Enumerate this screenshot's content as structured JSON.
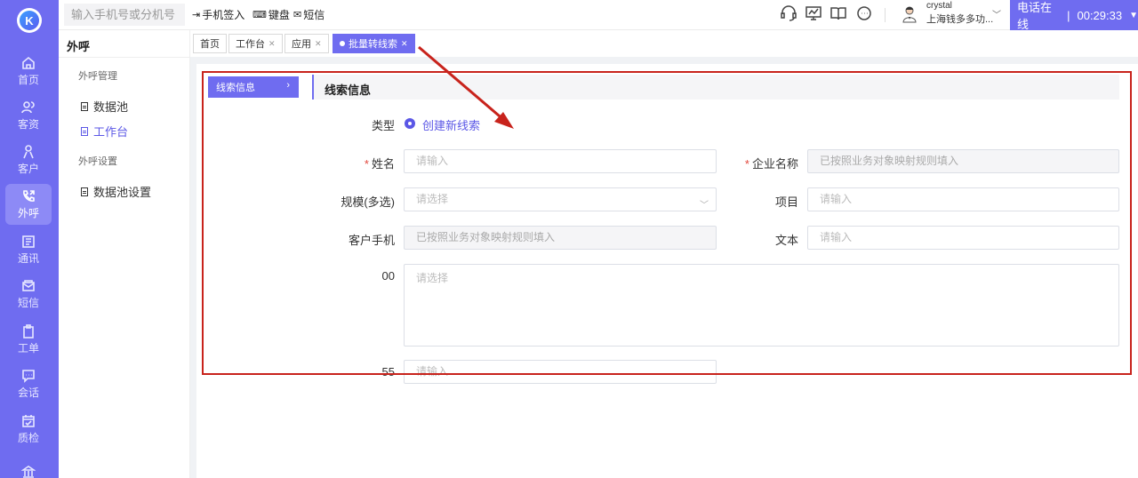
{
  "logo": {
    "letter": "K"
  },
  "rail": [
    {
      "label": "首页",
      "icon": "home-icon"
    },
    {
      "label": "客资",
      "icon": "users-icon"
    },
    {
      "label": "客户",
      "icon": "customer-icon"
    },
    {
      "label": "外呼",
      "icon": "outbound-call-icon",
      "active": true
    },
    {
      "label": "通讯",
      "icon": "contacts-icon"
    },
    {
      "label": "短信",
      "icon": "message-icon"
    },
    {
      "label": "工单",
      "icon": "clipboard-icon"
    },
    {
      "label": "会话",
      "icon": "chat-icon"
    },
    {
      "label": "质检",
      "icon": "quality-check-icon"
    },
    {
      "label": "",
      "icon": "bank-icon"
    }
  ],
  "topbar": {
    "search_placeholder": "输入手机号或分机号",
    "checkin": "手机签入",
    "keyboard": "键盘",
    "sms": "短信",
    "user_name": "crystal",
    "user_org": "上海钱多多功...",
    "status": "电话在线",
    "timer": "00:29:33"
  },
  "subnav": {
    "title": "外呼",
    "group1": "外呼管理",
    "items1": [
      "数据池",
      "工作台"
    ],
    "group2": "外呼设置",
    "items2": [
      "数据池设置"
    ]
  },
  "tabs": [
    {
      "label": "首页",
      "closable": false
    },
    {
      "label": "工作台",
      "closable": true
    },
    {
      "label": "应用",
      "closable": true
    },
    {
      "label": "批量转线索",
      "closable": true,
      "active": true
    }
  ],
  "form": {
    "section_btn": "线索信息",
    "section_title": "线索信息",
    "type_label": "类型",
    "type_value": "创建新线索",
    "name_label": "姓名",
    "name_placeholder": "请输入",
    "company_label": "企业名称",
    "company_placeholder": "已按照业务对象映射规则填入",
    "scale_label": "规模(多选)",
    "scale_placeholder": "请选择",
    "project_label": "项目",
    "project_placeholder": "请输入",
    "phone_label": "客户手机",
    "phone_placeholder": "已按照业务对象映射规则填入",
    "text_label": "文本",
    "text_placeholder": "请输入",
    "f00_label": "00",
    "f00_placeholder": "请选择",
    "f55_label": "55",
    "f55_placeholder": "请输入"
  },
  "colors": {
    "accent": "#6f6cf0",
    "annotation": "#c8231c"
  }
}
